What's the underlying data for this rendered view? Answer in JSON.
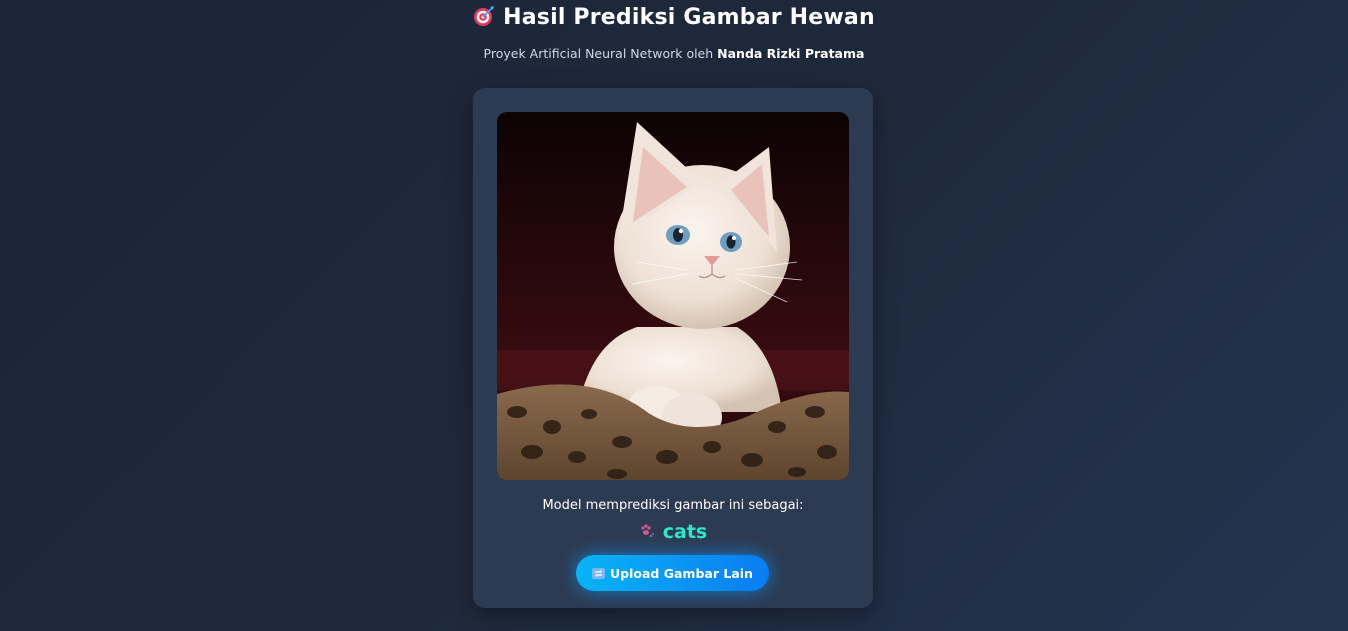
{
  "header": {
    "title": "Hasil Prediksi Gambar Hewan",
    "title_icon": "dart-target-icon",
    "subtitle_prefix": "Proyek Artificial Neural Network oleh ",
    "subtitle_author": "Nanda Rizki Pratama"
  },
  "card": {
    "image_subject": "kitten-photo",
    "caption": "Model memprediksi gambar ini sebagai:",
    "result_icon": "paw-icon",
    "result_label": "cats",
    "upload_button_icon": "repeat-icon",
    "upload_button_label": "Upload Gambar Lain"
  },
  "colors": {
    "background": "#1e293b",
    "card": "#2d3b52",
    "result_accent": "#2ee6c8",
    "button": "#0a8ff4"
  }
}
